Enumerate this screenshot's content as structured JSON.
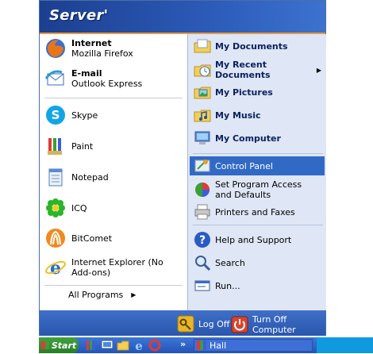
{
  "user": {
    "name": "Server'"
  },
  "left": {
    "pinned": [
      {
        "title": "Internet",
        "subtitle": "Mozilla Firefox",
        "icon": "firefox-icon"
      },
      {
        "title": "E-mail",
        "subtitle": "Outlook Express",
        "icon": "outlook-express-icon"
      }
    ],
    "recent": [
      {
        "label": "Skype",
        "icon": "skype-icon"
      },
      {
        "label": "Paint",
        "icon": "paint-icon"
      },
      {
        "label": "Notepad",
        "icon": "notepad-icon"
      },
      {
        "label": "ICQ",
        "icon": "icq-icon"
      },
      {
        "label": "BitComet",
        "icon": "bitcomet-icon"
      },
      {
        "label": "Internet Explorer (No Add-ons)",
        "icon": "internet-explorer-icon"
      }
    ],
    "all_programs": "All Programs"
  },
  "right": {
    "top": [
      {
        "label": "My Documents",
        "icon": "my-documents-icon"
      },
      {
        "label": "My Recent Documents",
        "icon": "my-recent-documents-icon"
      },
      {
        "label": "My Pictures",
        "icon": "my-pictures-icon"
      },
      {
        "label": "My Music",
        "icon": "my-music-icon"
      },
      {
        "label": "My Computer",
        "icon": "my-computer-icon"
      }
    ],
    "middle": [
      {
        "label": "Control Panel",
        "icon": "control-panel-icon"
      },
      {
        "label": "Set Program Access and Defaults",
        "icon": "program-access-icon"
      },
      {
        "label": "Printers and Faxes",
        "icon": "printer-icon"
      }
    ],
    "bottom": [
      {
        "label": "Help and Support",
        "icon": "help-icon"
      },
      {
        "label": "Search",
        "icon": "search-icon"
      },
      {
        "label": "Run...",
        "icon": "run-icon"
      }
    ]
  },
  "footer": {
    "log_off": "Log Off",
    "turn_off": "Turn Off Computer"
  },
  "taskbar": {
    "start": "Start",
    "window": "Hall"
  },
  "colors": {
    "header": "#2c5bb8",
    "highlight": "#316ac5",
    "right_pane": "#dfe6f5"
  }
}
